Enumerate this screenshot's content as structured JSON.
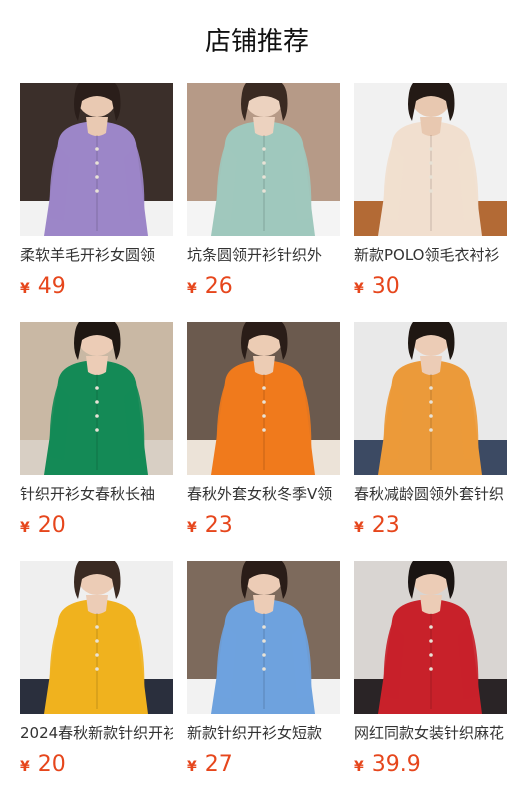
{
  "header": {
    "title": "店铺推荐"
  },
  "products": [
    {
      "name": "柔软羊毛开衫女圆领",
      "currency": "¥",
      "price": "49",
      "bg": "#3b2f2a",
      "garment": "#9c86c8",
      "skin": "#e9c9b2",
      "hair": "#2a1e1a",
      "bottom": "#f2f2f2"
    },
    {
      "name": "坑条圆领开衫针织外",
      "currency": "¥",
      "price": "26",
      "bg": "#b69a87",
      "garment": "#9fc8bd",
      "skin": "#ecd2bf",
      "hair": "#3a2a22",
      "bottom": "#f4f4f4"
    },
    {
      "name": "新款POLO领毛衣衬衫",
      "currency": "¥",
      "price": "30",
      "bg": "#f1f1f1",
      "garment": "#f1dfcf",
      "skin": "#e8c8b0",
      "hair": "#241a15",
      "bottom": "#b36a35"
    },
    {
      "name": "针织开衫女春秋长袖",
      "currency": "¥",
      "price": "20",
      "bg": "#c9b8a4",
      "garment": "#148a56",
      "skin": "#ecccb6",
      "hair": "#1f1712",
      "bottom": "#d8cfc4"
    },
    {
      "name": "春秋外套女秋冬季V领",
      "currency": "¥",
      "price": "23",
      "bg": "#6b5a4e",
      "garment": "#f07a1c",
      "skin": "#ecccb4",
      "hair": "#2a1d18",
      "bottom": "#ece3d8"
    },
    {
      "name": "春秋减龄圆领外套针织",
      "currency": "¥",
      "price": "23",
      "bg": "#e9e9e9",
      "garment": "#eb9a3a",
      "skin": "#ecccb6",
      "hair": "#1f1712",
      "bottom": "#3c4a63"
    },
    {
      "name": "2024春秋新款针织开衫",
      "currency": "¥",
      "price": "20",
      "bg": "#efefef",
      "garment": "#f0b21e",
      "skin": "#ecccb6",
      "hair": "#3a2a22",
      "bottom": "#2a2f3d"
    },
    {
      "name": "新款针织开衫女短款",
      "currency": "¥",
      "price": "27",
      "bg": "#7d6a5c",
      "garment": "#6ea2de",
      "skin": "#ecccb6",
      "hair": "#2a1d18",
      "bottom": "#f2f2f2"
    },
    {
      "name": "网红同款女装针织麻花",
      "currency": "¥",
      "price": "39.9",
      "bg": "#d9d5d2",
      "garment": "#c8212a",
      "skin": "#ecccb6",
      "hair": "#1a1412",
      "bottom": "#2a2426"
    }
  ]
}
